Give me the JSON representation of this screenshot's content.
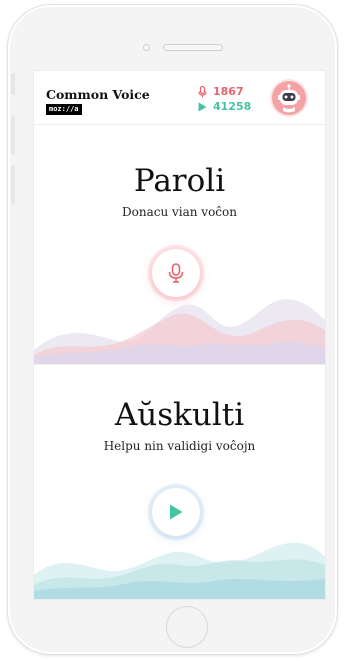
{
  "header": {
    "title": "Common Voice",
    "logo": "moz://a",
    "recorded_count": "1867",
    "validated_count": "41258",
    "avatar_icon": "robot-avatar-icon"
  },
  "speak": {
    "title": "Paroli",
    "subtitle": "Donacu vian voĉon",
    "button_icon": "microphone-icon"
  },
  "listen": {
    "title": "Aŭskulti",
    "subtitle": "Helpu nin validigi voĉojn",
    "button_icon": "play-icon"
  },
  "colors": {
    "speak_accent": "#e9636f",
    "listen_accent": "#45c4a5",
    "avatar_bg": "#f4a2a6"
  }
}
